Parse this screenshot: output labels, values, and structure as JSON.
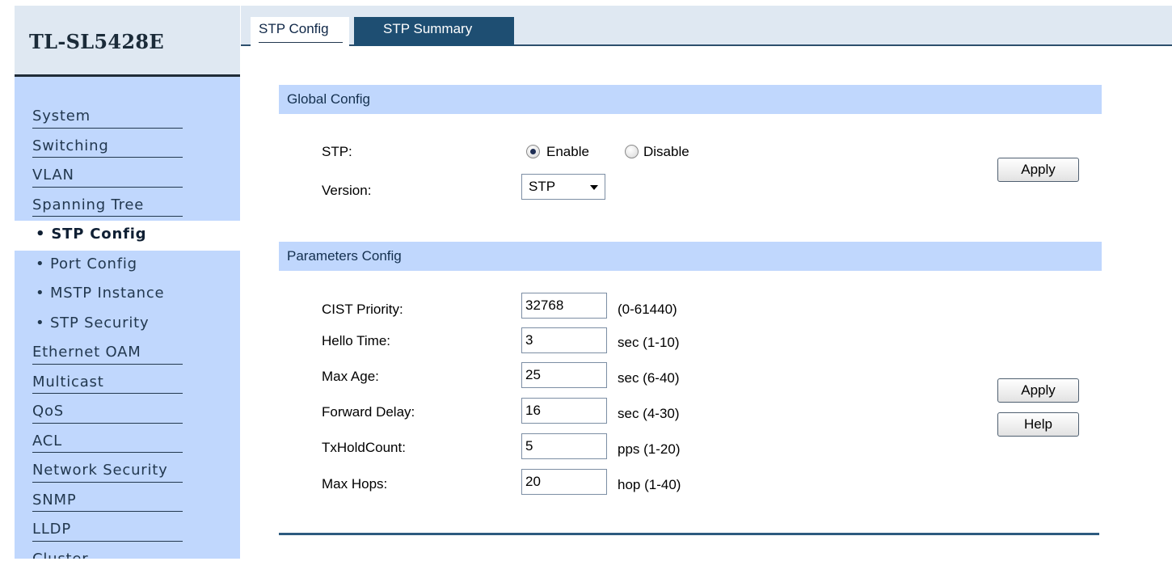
{
  "sidebar": {
    "brand": "TL-SL5428E",
    "items": [
      {
        "label": "System",
        "kind": "top"
      },
      {
        "label": "Switching",
        "kind": "top"
      },
      {
        "label": "VLAN",
        "kind": "top"
      },
      {
        "label": "Spanning Tree",
        "kind": "top"
      },
      {
        "label": "• STP Config",
        "kind": "sub",
        "active": true
      },
      {
        "label": "• Port Config",
        "kind": "sub"
      },
      {
        "label": "• MSTP Instance",
        "kind": "sub"
      },
      {
        "label": "• STP Security",
        "kind": "sub"
      },
      {
        "label": "Ethernet OAM",
        "kind": "top"
      },
      {
        "label": "Multicast",
        "kind": "top"
      },
      {
        "label": "QoS",
        "kind": "top"
      },
      {
        "label": "ACL",
        "kind": "top"
      },
      {
        "label": "Network Security",
        "kind": "top"
      },
      {
        "label": "SNMP",
        "kind": "top"
      },
      {
        "label": "LLDP",
        "kind": "top"
      },
      {
        "label": "Cluster",
        "kind": "top"
      }
    ]
  },
  "tabs": {
    "stp_config": "STP Config",
    "stp_summary": "STP Summary"
  },
  "global_config": {
    "title": "Global Config",
    "stp_label": "STP:",
    "enable_label": "Enable",
    "disable_label": "Disable",
    "stp_enabled": true,
    "version_label": "Version:",
    "version_value": "STP",
    "apply_label": "Apply"
  },
  "parameters_config": {
    "title": "Parameters Config",
    "fields": [
      {
        "label": "CIST Priority:",
        "value": "32768",
        "hint": "(0-61440)"
      },
      {
        "label": "Hello Time:",
        "value": "3",
        "hint": "sec (1-10)"
      },
      {
        "label": "Max Age:",
        "value": "25",
        "hint": "sec (6-40)"
      },
      {
        "label": "Forward Delay:",
        "value": "16",
        "hint": "sec (4-30)"
      },
      {
        "label": "TxHoldCount:",
        "value": "5",
        "hint": "pps (1-20)"
      },
      {
        "label": "Max Hops:",
        "value": "20",
        "hint": "hop (1-40)"
      }
    ],
    "apply_label": "Apply",
    "help_label": "Help"
  }
}
